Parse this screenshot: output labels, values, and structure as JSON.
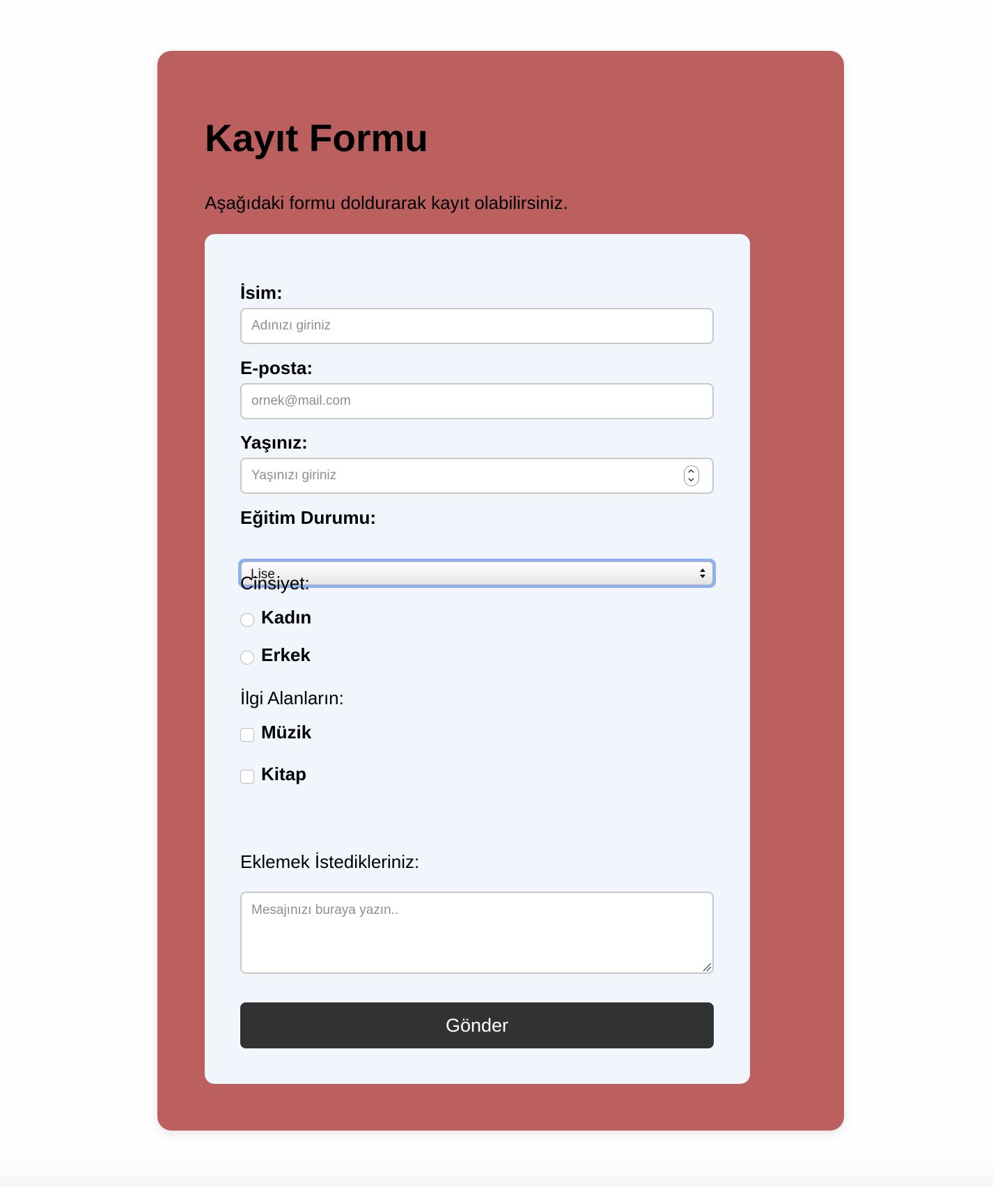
{
  "page": {
    "title": "Kayıt Formu",
    "subtitle": "Aşağıdaki formu doldurarak kayıt olabilirsiniz."
  },
  "form": {
    "name": {
      "label": "İsim:",
      "placeholder": "Adınızı giriniz",
      "value": ""
    },
    "email": {
      "label": "E-posta:",
      "placeholder": "ornek@mail.com",
      "value": ""
    },
    "age": {
      "label": "Yaşınız:",
      "placeholder": "Yaşınızı giriniz",
      "value": ""
    },
    "education": {
      "label": "Eğitim Durumu:",
      "selected": "Lise"
    },
    "gender": {
      "label": "Cinsiyet:",
      "options": [
        {
          "label": "Kadın",
          "checked": false
        },
        {
          "label": "Erkek",
          "checked": false
        }
      ]
    },
    "interests": {
      "label": "İlgi Alanların:",
      "options": [
        {
          "label": "Müzik",
          "checked": false
        },
        {
          "label": "Kitap",
          "checked": false
        }
      ]
    },
    "message": {
      "label": "Eklemek İstedikleriniz:",
      "placeholder": "Mesajınızı buraya yazın..",
      "value": ""
    },
    "submit_label": "Gönder"
  },
  "colors": {
    "outer_card": "#bb605e",
    "form_card": "#f0f6fc",
    "submit_button": "#333232",
    "focus_ring": "#8fb0f0"
  },
  "icons": {
    "stepper": "up-down-stepper-icon",
    "select": "select-arrows-icon",
    "textarea": "resize-grip-icon"
  }
}
